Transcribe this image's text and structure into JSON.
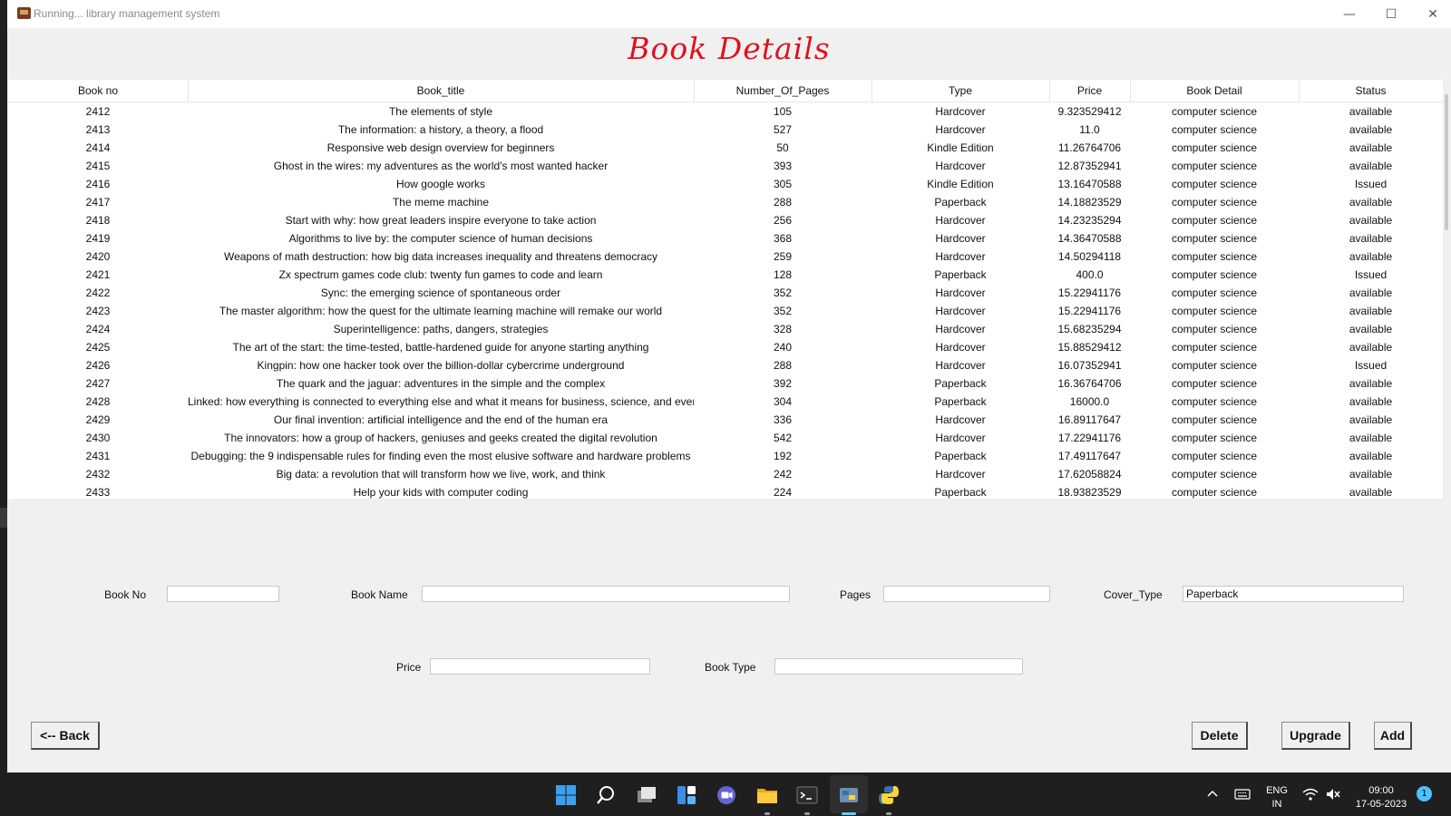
{
  "window": {
    "title": "Running... library management system",
    "minimize": "—",
    "maximize": "☐",
    "close": "✕"
  },
  "heading": "Book Details",
  "table": {
    "columns": [
      "Book no",
      "Book_title",
      "Number_Of_Pages",
      "Type",
      "Price",
      "Book Detail",
      "Status"
    ],
    "rows": [
      [
        "2412",
        "The elements of style",
        "105",
        "Hardcover",
        "9.323529412",
        "computer science",
        "available"
      ],
      [
        "2413",
        "The information: a history, a theory, a flood",
        "527",
        "Hardcover",
        "11.0",
        "computer science",
        "available"
      ],
      [
        "2414",
        "Responsive web design overview for beginners",
        "50",
        "Kindle Edition",
        "11.26764706",
        "computer science",
        "available"
      ],
      [
        "2415",
        "Ghost in the wires: my adventures as the world's most wanted hacker",
        "393",
        "Hardcover",
        "12.87352941",
        "computer science",
        "available"
      ],
      [
        "2416",
        "How google works",
        "305",
        "Kindle Edition",
        "13.16470588",
        "computer science",
        "Issued"
      ],
      [
        "2417",
        "The meme machine",
        "288",
        "Paperback",
        "14.18823529",
        "computer science",
        "available"
      ],
      [
        "2418",
        "Start with why: how great leaders inspire everyone to take action",
        "256",
        "Hardcover",
        "14.23235294",
        "computer science",
        "available"
      ],
      [
        "2419",
        "Algorithms to live by: the computer science of human decisions",
        "368",
        "Hardcover",
        "14.36470588",
        "computer science",
        "available"
      ],
      [
        "2420",
        "Weapons of math destruction: how big data increases inequality and threatens democracy",
        "259",
        "Hardcover",
        "14.50294118",
        "computer science",
        "available"
      ],
      [
        "2421",
        "Zx spectrum games code club: twenty fun games to code and learn",
        "128",
        "Paperback",
        "400.0",
        "computer science",
        "Issued"
      ],
      [
        "2422",
        "Sync: the emerging science of spontaneous order",
        "352",
        "Hardcover",
        "15.22941176",
        "computer science",
        "available"
      ],
      [
        "2423",
        "The master algorithm: how the quest for the ultimate learning machine will remake our world",
        "352",
        "Hardcover",
        "15.22941176",
        "computer science",
        "available"
      ],
      [
        "2424",
        "Superintelligence: paths, dangers, strategies",
        "328",
        "Hardcover",
        "15.68235294",
        "computer science",
        "available"
      ],
      [
        "2425",
        "The art of the start: the time-tested, battle-hardened guide for anyone starting anything",
        "240",
        "Hardcover",
        "15.88529412",
        "computer science",
        "available"
      ],
      [
        "2426",
        "Kingpin: how one hacker took over the billion-dollar cybercrime underground",
        "288",
        "Hardcover",
        "16.07352941",
        "computer science",
        "Issued"
      ],
      [
        "2427",
        "The quark and the jaguar: adventures in the simple and the complex",
        "392",
        "Paperback",
        "16.36764706",
        "computer science",
        "available"
      ],
      [
        "2428",
        "Linked: how everything is connected to everything else and what it means for business, science, and everyc",
        "304",
        "Paperback",
        "16000.0",
        "computer science",
        "available"
      ],
      [
        "2429",
        "Our final invention: artificial intelligence and the end of the human era",
        "336",
        "Hardcover",
        "16.89117647",
        "computer science",
        "available"
      ],
      [
        "2430",
        "The innovators: how a group of hackers, geniuses and geeks created the digital revolution",
        "542",
        "Hardcover",
        "17.22941176",
        "computer science",
        "available"
      ],
      [
        "2431",
        "Debugging: the 9 indispensable rules for finding even the most elusive software and hardware problems",
        "192",
        "Paperback",
        "17.49117647",
        "computer science",
        "available"
      ],
      [
        "2432",
        "Big data: a revolution that will transform how we live, work, and think",
        "242",
        "Hardcover",
        "17.62058824",
        "computer science",
        "available"
      ],
      [
        "2433",
        "Help your kids with computer coding",
        "224",
        "Paperback",
        "18.93823529",
        "computer science",
        "available"
      ]
    ]
  },
  "form": {
    "book_no_label": "Book No",
    "book_no_value": "",
    "book_name_label": "Book Name",
    "book_name_value": "",
    "pages_label": "Pages",
    "pages_value": "",
    "cover_type_label": "Cover_Type",
    "cover_type_value": "Paperback",
    "price_label": "Price",
    "price_value": "",
    "book_type_label": "Book Type",
    "book_type_value": ""
  },
  "buttons": {
    "back": "<-- Back",
    "delete": "Delete",
    "upgrade": "Upgrade",
    "add": "Add"
  },
  "taskbar": {
    "icons": [
      "windows-start-icon",
      "search-icon",
      "task-view-icon",
      "widgets-icon",
      "teams-chat-icon",
      "file-explorer-icon",
      "terminal-icon",
      "python-idle-icon",
      "python-icon"
    ],
    "language": "ENG",
    "region": "IN",
    "time": "09:00",
    "date": "17-05-2023",
    "notification_count": "1"
  },
  "colors": {
    "heading": "#e0111d",
    "window_bg": "#f0f0f0",
    "taskbar_bg": "#1f1f1f"
  }
}
